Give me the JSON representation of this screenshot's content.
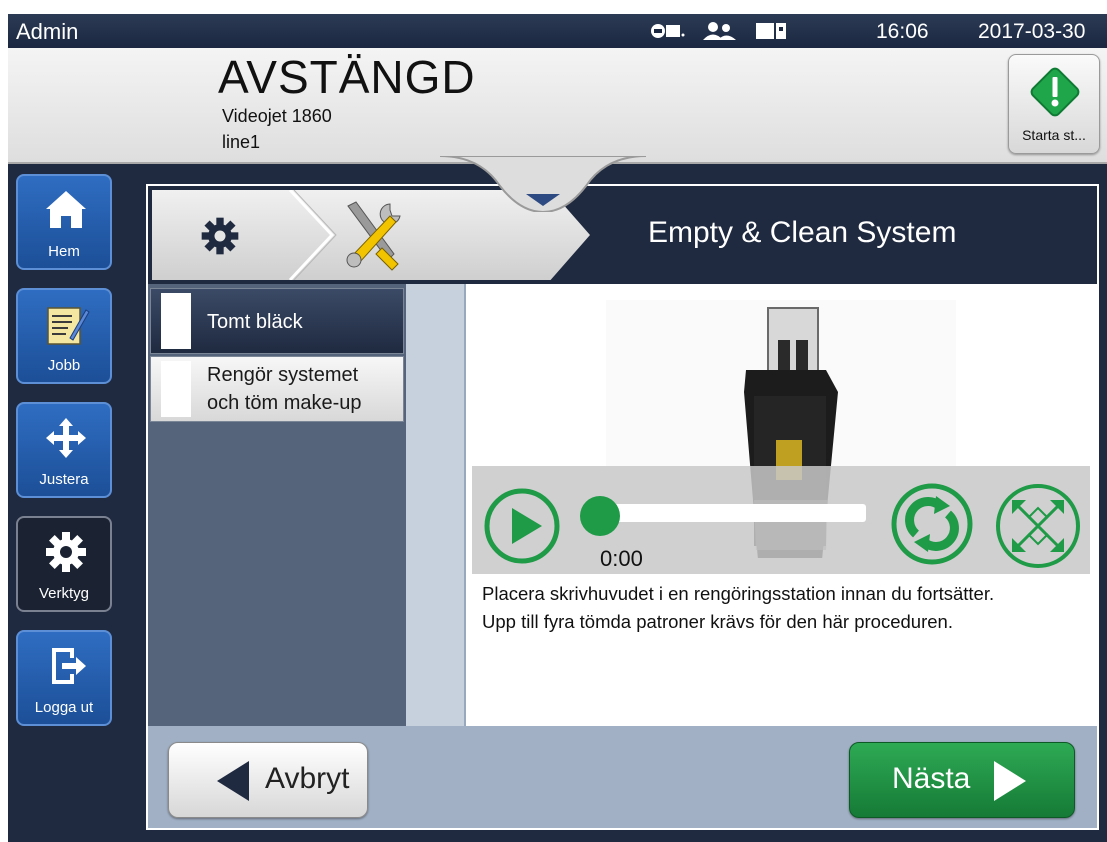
{
  "status_bar": {
    "user": "Admin",
    "time": "16:06",
    "date": "2017-03-30",
    "icons": [
      "network-icon",
      "users-icon",
      "cartridge-icon"
    ]
  },
  "header": {
    "state": "AVSTÄNGD",
    "model": "Videojet 1860",
    "line": "line1",
    "start_button_label": "Starta st..."
  },
  "nav": {
    "items": [
      {
        "label": "Hem",
        "icon": "home-icon"
      },
      {
        "label": "Jobb",
        "icon": "job-icon"
      },
      {
        "label": "Justera",
        "icon": "move-icon"
      },
      {
        "label": "Verktyg",
        "icon": "gear-icon"
      },
      {
        "label": "Logga ut",
        "icon": "logout-icon"
      }
    ]
  },
  "panel": {
    "title": "Empty & Clean System",
    "steps": [
      {
        "label_line1": "Tomt bläck",
        "label_line2": ""
      },
      {
        "label_line1": "Rengör systemet",
        "label_line2": "och töm make-up"
      }
    ],
    "video": {
      "elapsed": "0:00",
      "progress": 0
    },
    "instructions": [
      "Placera skrivhuvudet i en rengöringsstation innan du fortsätter.",
      "Upp till fyra tömda patroner krävs för den här proceduren."
    ]
  },
  "footer": {
    "cancel_label": "Avbryt",
    "next_label": "Nästa"
  },
  "colors": {
    "accent_green": "#1f9a47",
    "nav_blue": "#2f6dc2",
    "dark_bg": "#1f2a40"
  }
}
